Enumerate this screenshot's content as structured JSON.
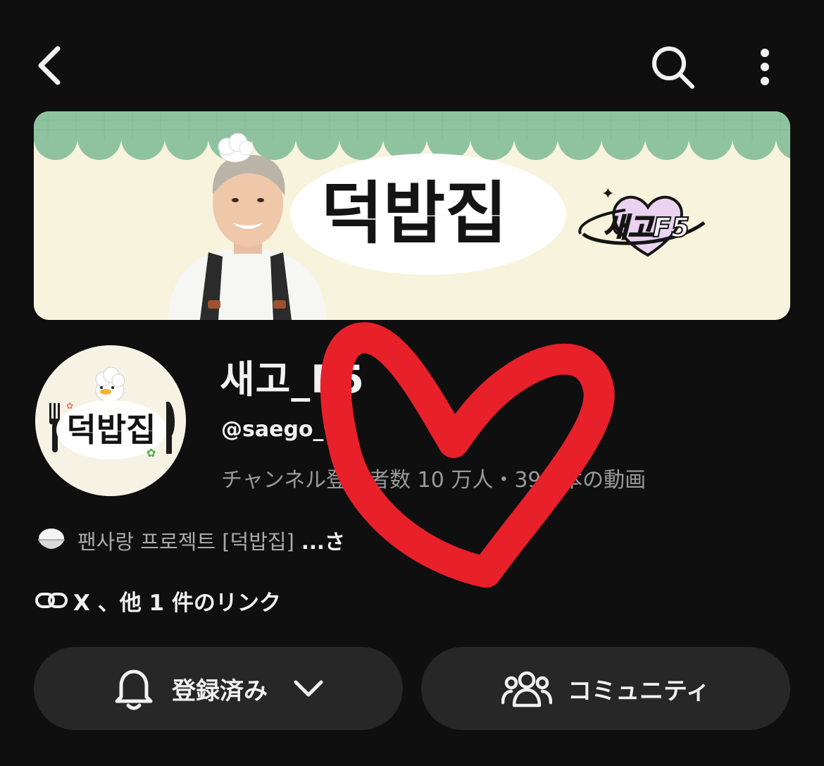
{
  "banner": {
    "title": "덕밥집",
    "logo_text": "새고F5"
  },
  "channel": {
    "avatar_title": "덕밥집",
    "name": "새고_F5",
    "handle": "@saego_f5",
    "stats": "チャンネル登録者数 10 万人・398 本の動画",
    "description": "팬사랑 프로젝트 [덕밥집] ...さらに表示",
    "description_visible": "팬사랑 프로젝트 [덕밥집]",
    "description_more": "...さ",
    "links": "X 、他 1 件のリンク"
  },
  "actions": {
    "subscribe_label": "登録済み",
    "community_label": "コミュニティ"
  },
  "colors": {
    "background": "#0f0f0f",
    "button_bg": "#272727",
    "heart_doodle": "#e8202a",
    "banner_scallop": "#8fc3a0",
    "banner_bg": "#f8f3dc"
  },
  "icons": {
    "back": "chevron-left-icon",
    "search": "search-icon",
    "more": "more-vertical-icon",
    "bell": "bell-icon",
    "dropdown": "chevron-down-icon",
    "community": "people-icon",
    "link": "link-icon",
    "rice": "rice-bowl-icon"
  }
}
